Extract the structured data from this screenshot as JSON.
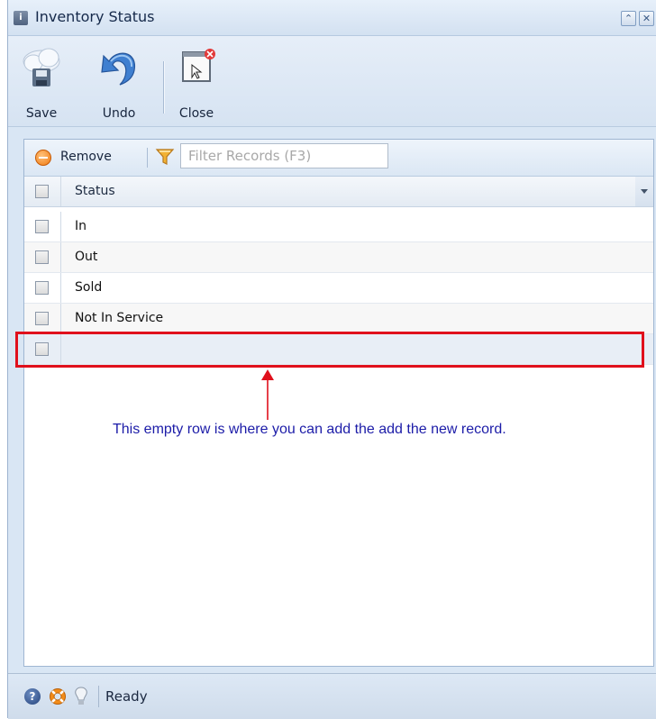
{
  "window": {
    "title": "Inventory Status",
    "collapse_glyph": "⌃",
    "close_glyph": "✕"
  },
  "toolbar": {
    "save_label": "Save",
    "undo_label": "Undo",
    "close_label": "Close"
  },
  "grid": {
    "remove_label": "Remove",
    "filter_placeholder": "Filter Records (F3)",
    "filter_value": "",
    "column_header": "Status",
    "rows": [
      "In",
      "Out",
      "Sold",
      "Not In Service",
      ""
    ]
  },
  "annotation": {
    "text": "This empty row is where you can add the add the new record.",
    "color": "#1c1ca8",
    "box_color": "#e0101c"
  },
  "statusbar": {
    "status_text": "Ready"
  },
  "icons": {
    "window": "info-icon",
    "save": "cloud-save-icon",
    "undo": "undo-arrow-icon",
    "close": "close-window-icon",
    "remove": "remove-icon",
    "filter": "filter-funnel-icon",
    "help": "help-icon",
    "support": "lifebuoy-icon",
    "tip": "lightbulb-icon"
  }
}
